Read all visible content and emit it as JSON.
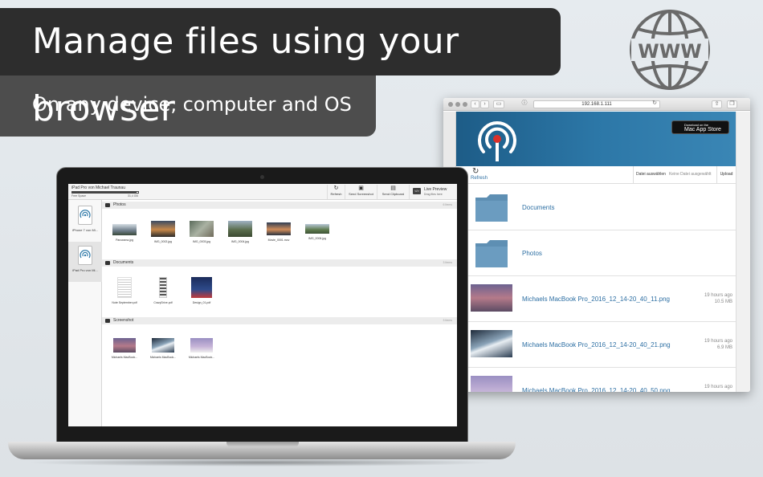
{
  "banner": {
    "headline": "Manage files using your browser",
    "subline": "On any device, computer and OS"
  },
  "globe": {
    "text": "WWW",
    "icon": "globe-icon"
  },
  "browser": {
    "url": "192.168.1.111",
    "appstore_small": "Download on the",
    "appstore_big": "Mac App Store",
    "refresh": "Refresh",
    "choose_file": "Datei auswählen",
    "no_file": "Keine Datei ausgewählt",
    "upload": "Upload",
    "rows": [
      {
        "type": "folder",
        "name": "Documents",
        "time": "",
        "size": ""
      },
      {
        "type": "folder",
        "name": "Photos",
        "time": "",
        "size": ""
      },
      {
        "type": "image",
        "name": "Michaels MacBook Pro_2016_12_14-20_40_11.png",
        "time": "19 hours ago",
        "size": "10.5 MB"
      },
      {
        "type": "image",
        "name": "Michaels MacBook Pro_2016_12_14-20_40_21.png",
        "time": "19 hours ago",
        "size": "6.9 MB"
      },
      {
        "type": "image",
        "name": "Michaels MacBook Pro_2016_12_14-20_40_50.png",
        "time": "19 hours ago",
        "size": ""
      }
    ],
    "colors": {
      "header": "#2c77a7",
      "link": "#2d6fa3"
    }
  },
  "mac_app": {
    "device_title": "iPad Pro von Michael Traunau",
    "free_space": "Free Space",
    "storage_size": "31,4 GB",
    "storage_used_fraction": 0.98,
    "toolbar": {
      "refresh": "Refresh",
      "send_screenshot": "Send Screenshot",
      "send_clipboard": "Send Clipboard",
      "live_preview": "Live Preview",
      "live_hint": "Drag files here",
      "live_icon_text": "</>"
    },
    "devices": [
      {
        "label": "iPhone 7 von Mi..."
      },
      {
        "label": "iPad Pro von Mi..."
      }
    ],
    "sections": [
      {
        "name": "Photos",
        "count": "6 Items",
        "items": [
          "Panorama.jpg",
          "IMG_0002.jpg",
          "IMG_0003.jpg",
          "IMG_0004.jpg",
          "Movie_0001.mov",
          "IMG_0006.jpg"
        ]
      },
      {
        "name": "Documents",
        "count": "3 Items",
        "items": [
          "Note September.pdf",
          "CrazyDrive.pdf",
          "Design_01.pdf"
        ]
      },
      {
        "name": "Screenshot",
        "count": "3 Items",
        "items": [
          "Michaels MacBook...",
          "Michaels MacBook...",
          "Michaels MacBook..."
        ]
      }
    ]
  }
}
